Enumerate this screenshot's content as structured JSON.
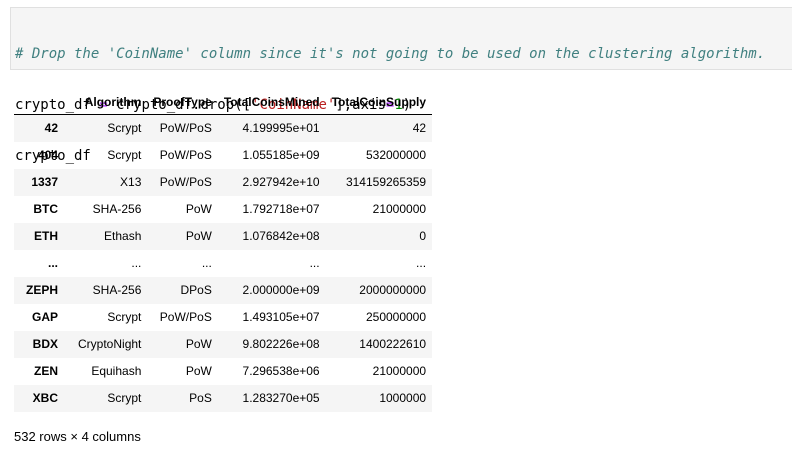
{
  "code": {
    "line1_comment": "# Drop the 'CoinName' column since it's not going to be used on the clustering algorithm.",
    "line2": {
      "lhs": "crypto_df ",
      "op": "=",
      "mid": " crypto_df.drop([",
      "str": "'CoinName'",
      "tail1": "],axis",
      "op2": "=",
      "num": "1",
      "tail2": ")"
    },
    "line3": "crypto_df"
  },
  "table": {
    "columns": [
      "",
      "Algorithm",
      "ProofType",
      "TotalCoinsMined",
      "TotalCoinSupply"
    ],
    "rows": [
      {
        "index": "42",
        "cells": [
          "Scrypt",
          "PoW/PoS",
          "4.199995e+01",
          "42"
        ]
      },
      {
        "index": "404",
        "cells": [
          "Scrypt",
          "PoW/PoS",
          "1.055185e+09",
          "532000000"
        ]
      },
      {
        "index": "1337",
        "cells": [
          "X13",
          "PoW/PoS",
          "2.927942e+10",
          "314159265359"
        ]
      },
      {
        "index": "BTC",
        "cells": [
          "SHA-256",
          "PoW",
          "1.792718e+07",
          "21000000"
        ]
      },
      {
        "index": "ETH",
        "cells": [
          "Ethash",
          "PoW",
          "1.076842e+08",
          "0"
        ]
      },
      {
        "index": "...",
        "cells": [
          "...",
          "...",
          "...",
          "..."
        ]
      },
      {
        "index": "ZEPH",
        "cells": [
          "SHA-256",
          "DPoS",
          "2.000000e+09",
          "2000000000"
        ]
      },
      {
        "index": "GAP",
        "cells": [
          "Scrypt",
          "PoW/PoS",
          "1.493105e+07",
          "250000000"
        ]
      },
      {
        "index": "BDX",
        "cells": [
          "CryptoNight",
          "PoW",
          "9.802226e+08",
          "1400222610"
        ]
      },
      {
        "index": "ZEN",
        "cells": [
          "Equihash",
          "PoW",
          "7.296538e+06",
          "21000000"
        ]
      },
      {
        "index": "XBC",
        "cells": [
          "Scrypt",
          "PoS",
          "1.283270e+05",
          "1000000"
        ]
      }
    ]
  },
  "footer": "532 rows × 4 columns"
}
